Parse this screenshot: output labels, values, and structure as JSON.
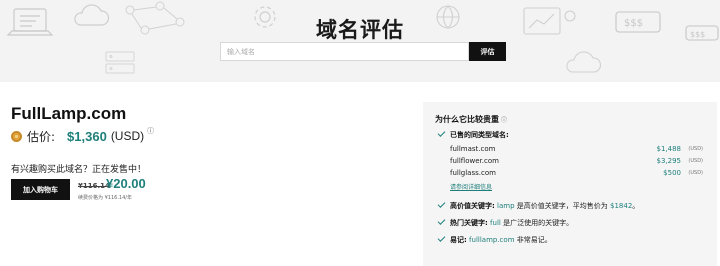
{
  "hero": {
    "title": "域名评估",
    "search_placeholder": "输入域名",
    "search_button": "评估"
  },
  "domain": {
    "name": "FullLamp.com",
    "estimate_label": "估价:",
    "estimate_value": "$1,360",
    "estimate_currency": "(USD)"
  },
  "sale": {
    "interest_text": "有兴趣购买此域名？正在发售中！",
    "cart_button": "加入购物车",
    "old_price": "¥116.14",
    "new_price": "¥20.00",
    "renew_note": "续费价格为 ¥116.14/年"
  },
  "panel": {
    "title": "为什么它比较贵重",
    "sold_title": "已售的同类型域名:",
    "sold_domains": [
      {
        "name": "fullmast.com",
        "price": "$1,488",
        "unit": "(USD)"
      },
      {
        "name": "fullflower.com",
        "price": "$3,295",
        "unit": "(USD)"
      },
      {
        "name": "fullglass.com",
        "price": "$500",
        "unit": "(USD)"
      }
    ],
    "sold_link": "请参阅详细信息",
    "features": {
      "high_value": {
        "label": "高价值关键字:",
        "keyword": "lamp",
        "text": "是高价值关键字，平均售价为",
        "avg_price": "$1842",
        "end": "。"
      },
      "popular": {
        "label": "热门关键字:",
        "keyword": "full",
        "text": "是广泛使用的关键字。"
      },
      "memorable": {
        "label": "易记:",
        "keyword": "fulllamp.com",
        "text": "非常易记。"
      }
    }
  },
  "colors": {
    "accent": "#1e7f7b",
    "button_bg": "#111111",
    "hero_bg": "#f3f3f3",
    "panel_bg": "#f5f5f5",
    "coin": "#e0a53a"
  },
  "icons": [
    "coin-icon",
    "help-icon",
    "check-icon",
    "laptop-icon",
    "cloud-icon",
    "gear-icon",
    "dollar-icon",
    "globe-icon",
    "server-icon"
  ]
}
